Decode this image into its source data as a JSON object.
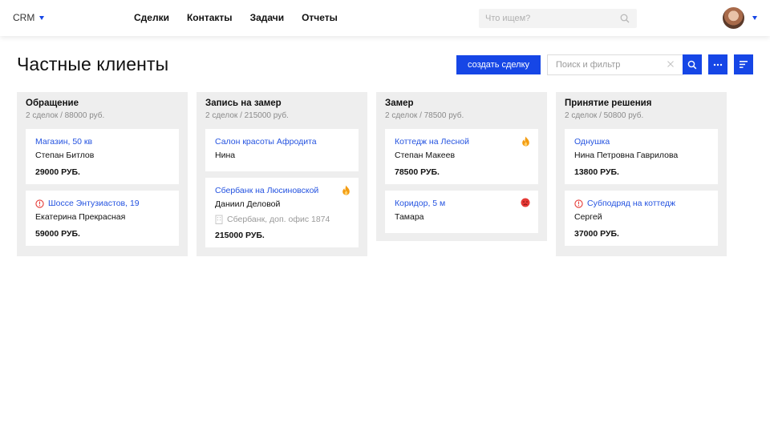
{
  "app": {
    "brand": "CRM"
  },
  "nav": [
    "Сделки",
    "Контакты",
    "Задачи",
    "Отчеты"
  ],
  "search": {
    "placeholder": "Что ищем?"
  },
  "page": {
    "title": "Частные клиенты",
    "create_label": "создать сделку",
    "filter_placeholder": "Поиск и фильтр"
  },
  "columns": [
    {
      "title": "Обращение",
      "summary": "2 сделок / 88000 руб.",
      "cards": [
        {
          "title": "Магазин, 50 кв",
          "person": "Степан Битлов",
          "amount": "29000 РУБ."
        },
        {
          "title": "Шоссе Энтузиастов, 19",
          "person": "Екатерина Прекрасная",
          "amount": "59000 РУБ.",
          "alert": true
        }
      ]
    },
    {
      "title": "Запись на замер",
      "summary": "2 сделок / 215000 руб.",
      "cards": [
        {
          "title": "Салон красоты Афродита",
          "person": "Нина"
        },
        {
          "title": "Сбербанк на Люсиновской",
          "person": "Даниил Деловой",
          "company": "Сбербанк, доп. офис 1874",
          "amount": "215000 РУБ.",
          "badge": "fire-icon"
        }
      ]
    },
    {
      "title": "Замер",
      "summary": "2 сделок / 78500 руб.",
      "cards": [
        {
          "title": "Коттедж на Лесной",
          "person": "Степан Макеев",
          "amount": "78500 РУБ.",
          "badge": "fire-icon"
        },
        {
          "title": "Коридор, 5 м",
          "person": "Тамара",
          "badge": "angry-face-icon"
        }
      ]
    },
    {
      "title": "Принятие решения",
      "summary": "2 сделок / 50800 руб.",
      "cards": [
        {
          "title": "Однушка",
          "person": "Нина Петровна Гаврилова",
          "amount": "13800 РУБ."
        },
        {
          "title": "Субподряд на коттедж",
          "person": "Сергей",
          "amount": "37000 РУБ.",
          "alert": true
        }
      ]
    }
  ],
  "colors": {
    "accent": "#1646e6",
    "link": "#2453e0",
    "alert": "#e53935",
    "fire": "#f39c12",
    "column_bg": "#eeeeee"
  }
}
